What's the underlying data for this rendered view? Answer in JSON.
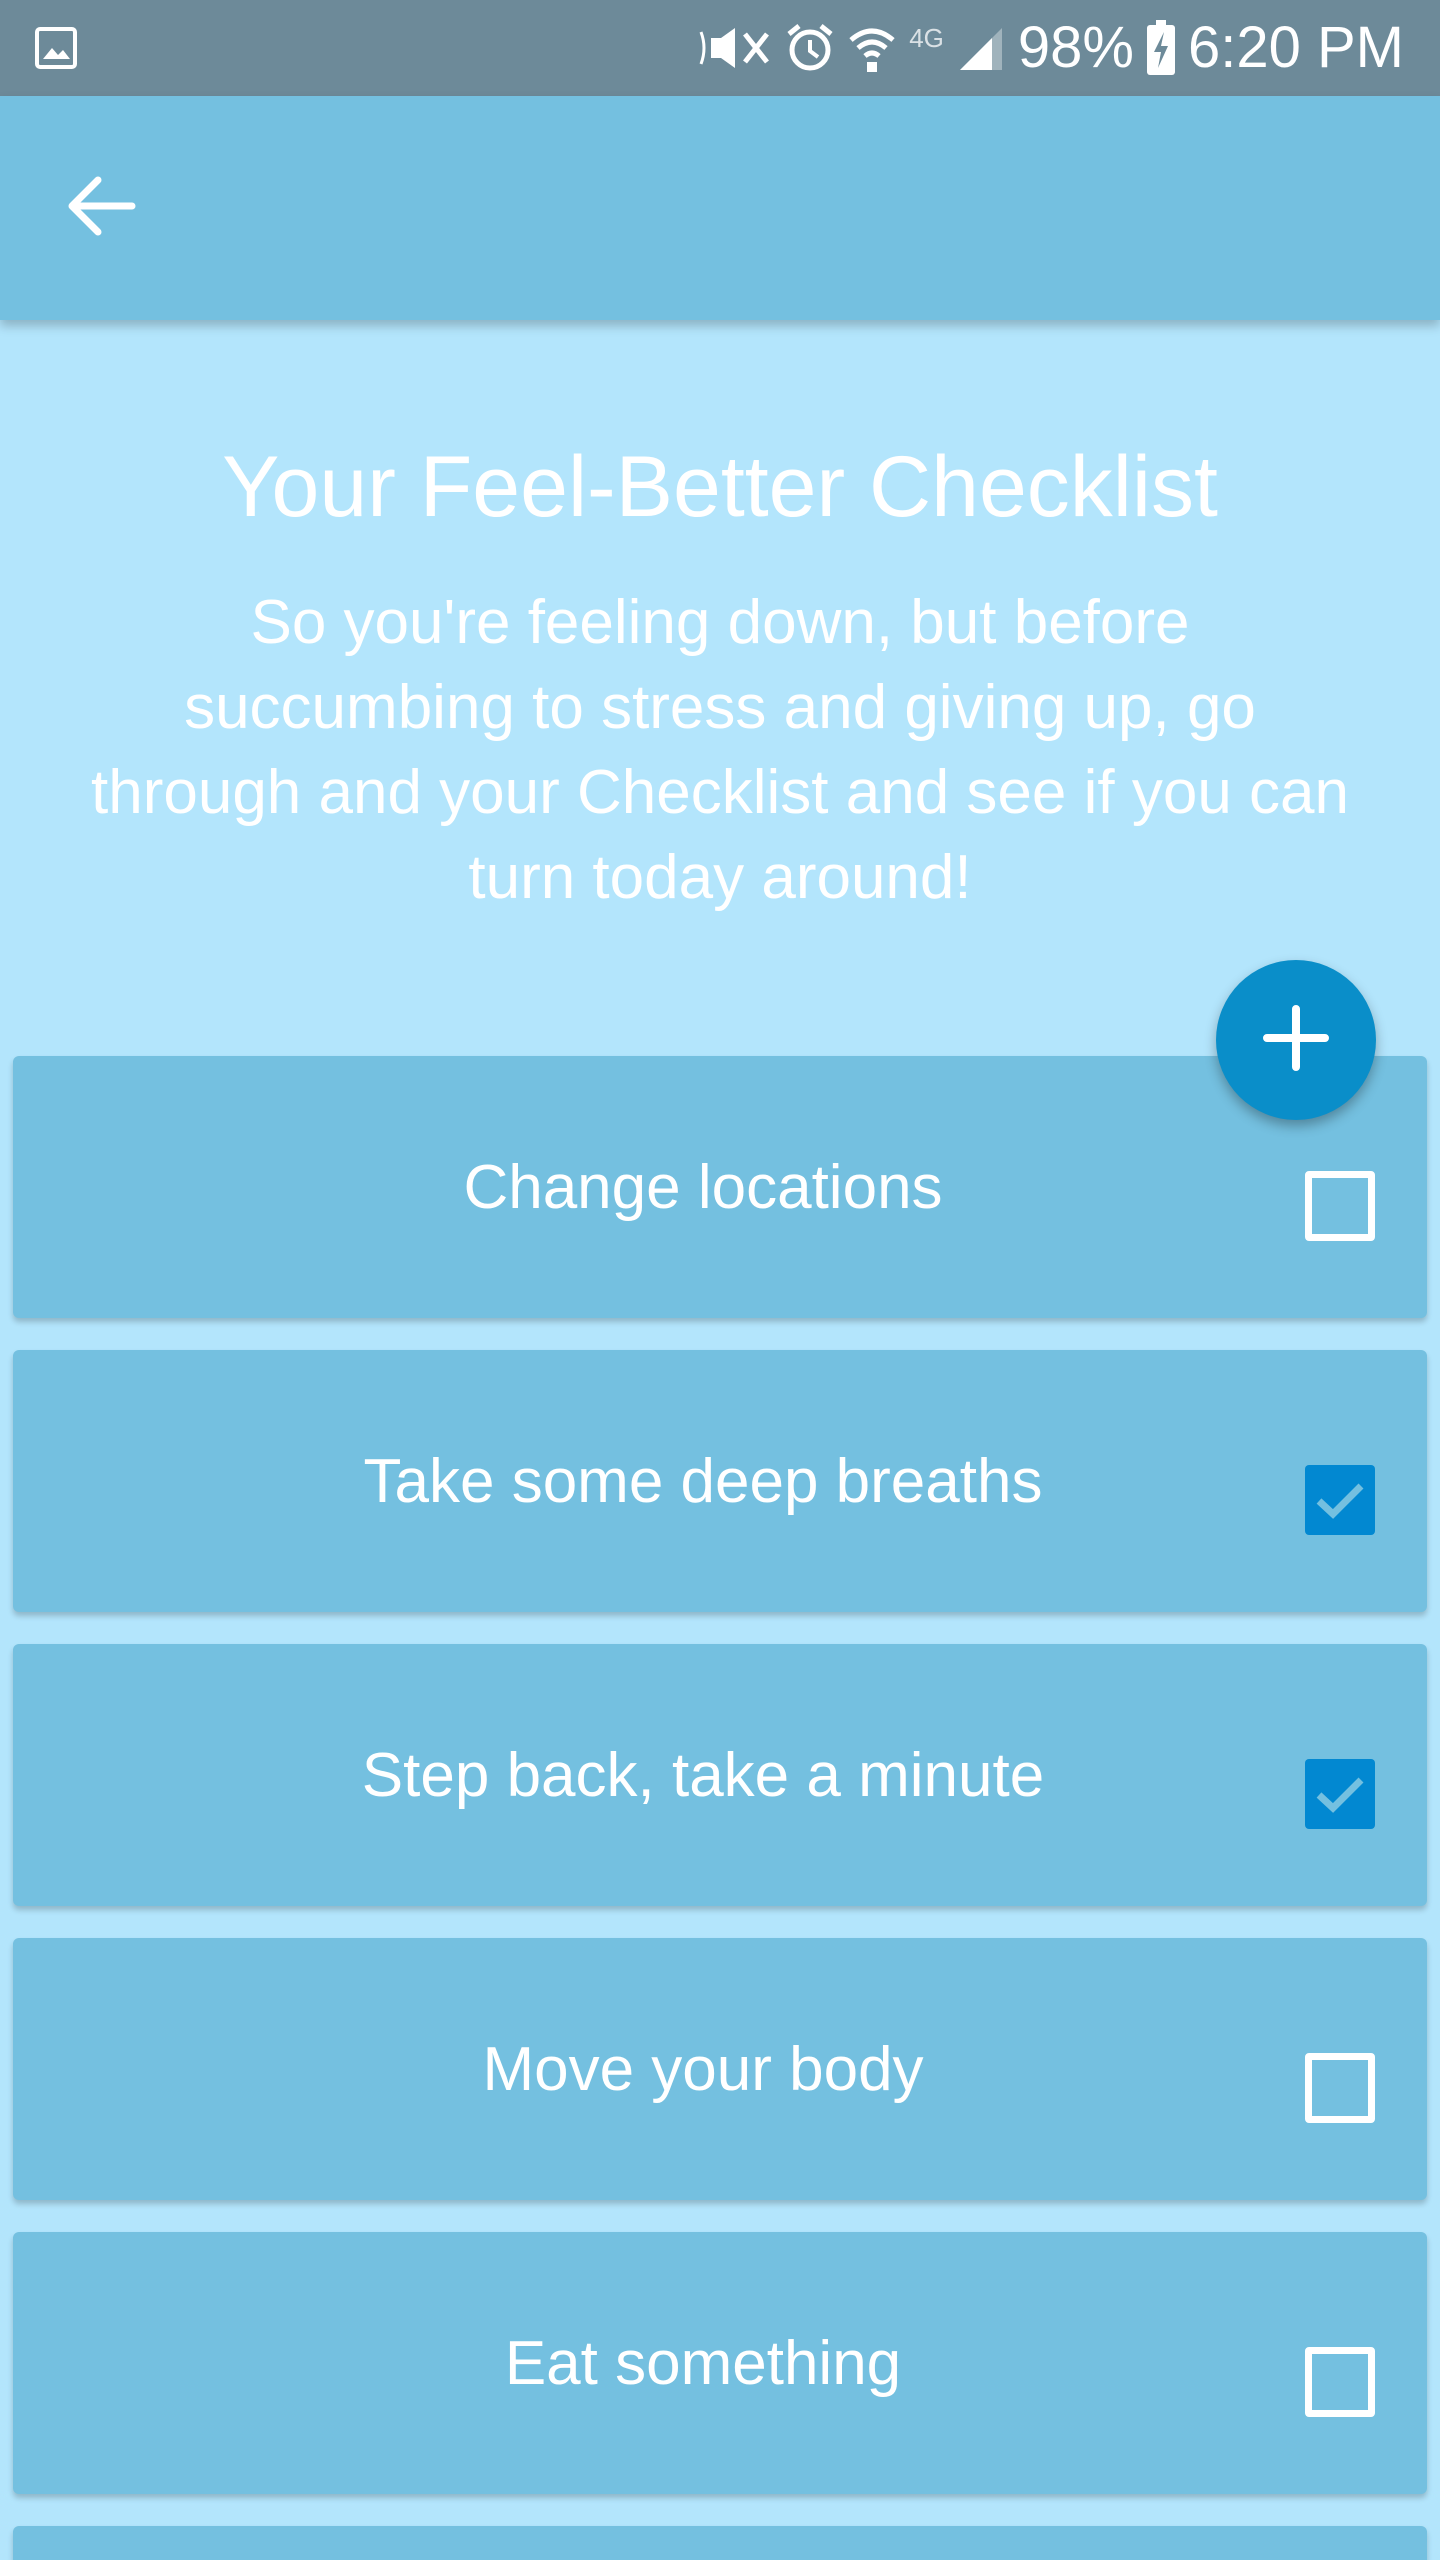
{
  "status_bar": {
    "battery": "98%",
    "time": "6:20 PM",
    "network": "4G",
    "icons": [
      "image-icon",
      "mute-icon",
      "alarm-icon",
      "wifi-icon",
      "signal-icon",
      "battery-charging-icon"
    ]
  },
  "app_bar": {
    "back_icon": "arrow-back-icon",
    "color": "#74c0e0"
  },
  "header": {
    "title": "Your Feel-Better Checklist",
    "intro": "So you're feeling down, but before succumbing to stress and giving up, go through and your Checklist and see if you can turn today around!"
  },
  "fab": {
    "icon": "plus-icon",
    "color": "#0a8ec9"
  },
  "checklist": {
    "items": [
      {
        "label": "Change locations",
        "checked": false
      },
      {
        "label": "Take some deep breaths",
        "checked": true
      },
      {
        "label": "Step back, take a minute",
        "checked": true
      },
      {
        "label": "Move your body",
        "checked": false
      },
      {
        "label": "Eat something",
        "checked": false
      }
    ]
  },
  "colors": {
    "background": "#b3e5fc",
    "card": "#74c0e0",
    "checkbox_checked": "#0288d1",
    "status_bar": "#6d8a99"
  }
}
